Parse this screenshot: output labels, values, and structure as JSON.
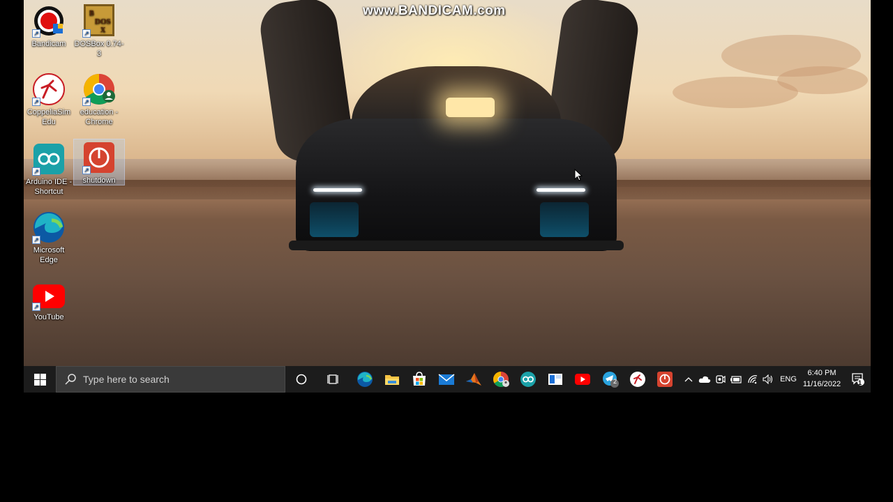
{
  "watermark": "www.BANDICAM.com",
  "desktop_icons": [
    {
      "label": "Bandicam",
      "icon": "bandicam-icon"
    },
    {
      "label": "DOSBox 0.74-3",
      "icon": "dosbox-icon"
    },
    {
      "label": "CoppeliaSim Edu",
      "icon": "coppeliasim-icon"
    },
    {
      "label": "education - Chrome",
      "icon": "chrome-icon"
    },
    {
      "label": "Arduino IDE - Shortcut",
      "icon": "arduino-icon"
    },
    {
      "label": "shutdown",
      "icon": "shutdown-icon"
    },
    {
      "label": "Microsoft Edge",
      "icon": "edge-icon"
    },
    {
      "label": "YouTube",
      "icon": "youtube-icon"
    }
  ],
  "taskbar": {
    "search_placeholder": "Type here to search",
    "pinned": [
      "cortana-icon",
      "task-view-icon",
      "edge-icon",
      "file-explorer-icon",
      "microsoft-store-icon",
      "mail-icon",
      "matlab-icon",
      "chrome-icon",
      "arduino-icon",
      "whiteboard-icon",
      "youtube-icon",
      "telegram-icon",
      "coppeliasim-icon",
      "shutdown-icon"
    ],
    "telegram_badge": "2",
    "language": "ENG",
    "time": "6:40 PM",
    "date": "11/16/2022",
    "notification_count": "1"
  }
}
